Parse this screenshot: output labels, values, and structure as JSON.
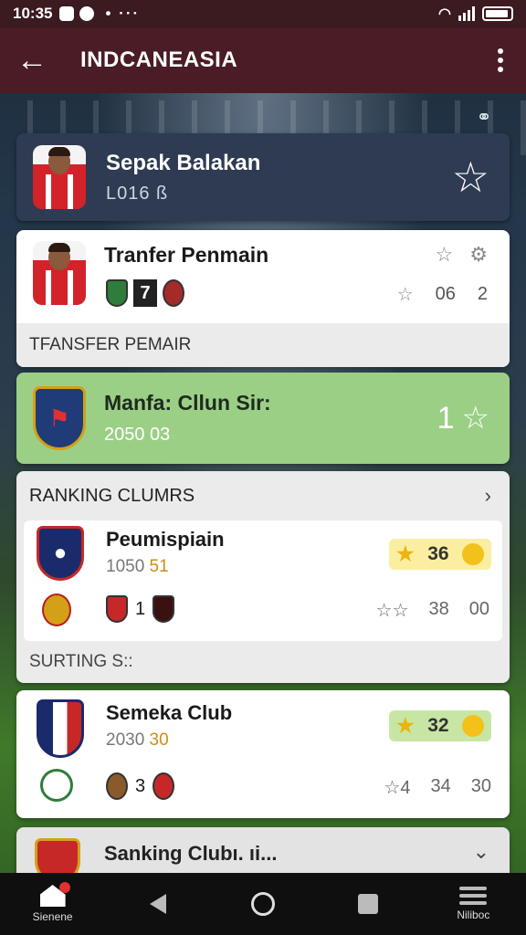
{
  "status_bar": {
    "time": "10:35",
    "more": "• ···"
  },
  "app_bar": {
    "back_icon": "arrow-left-icon",
    "title": "INDCANEASIA",
    "menu_icon": "more-vert-icon"
  },
  "hero": {
    "title": "Sepak Balakan",
    "subtitle": "L016 ß"
  },
  "transfer_card": {
    "title": "Tranfer Penmain",
    "badge_number": "7",
    "stat_a": "06",
    "stat_b": "2",
    "footer": "TFANSFER PEMAIR"
  },
  "manfa_card": {
    "title": "Manfa: Cllun Sir:",
    "subtitle": "2050 03",
    "rank": "1",
    "rank_icon": "star-outline-icon"
  },
  "ranking_card": {
    "header": "RANKING CLUMRS",
    "item": {
      "name": "Peumispiain",
      "sub_prefix": "1050 ",
      "sub_highlight": "51",
      "pill_value": "36",
      "mid_number": "1",
      "stat_a": "38",
      "stat_b": "00"
    },
    "footer": "SURTING S::"
  },
  "semeka_card": {
    "name": "Semeka Club",
    "sub_prefix": "2030 ",
    "sub_highlight": "30",
    "pill_value": "32",
    "mid_number": "3",
    "stat_star": "4",
    "stat_a": "34",
    "stat_b": "30"
  },
  "sanking_card": {
    "name": "Sanking Clubı. ıi..."
  },
  "nav": {
    "home_label": "Sienene",
    "menu_label": "Niliboc"
  },
  "colors": {
    "app_bar": "#4a1c25",
    "hero_bg": "#2e3b52",
    "manfa_bg": "#9bcf86",
    "pill_bg": "#fbeea0",
    "pill_green": "#c7e6a4",
    "accent_gold": "#d08a16"
  }
}
